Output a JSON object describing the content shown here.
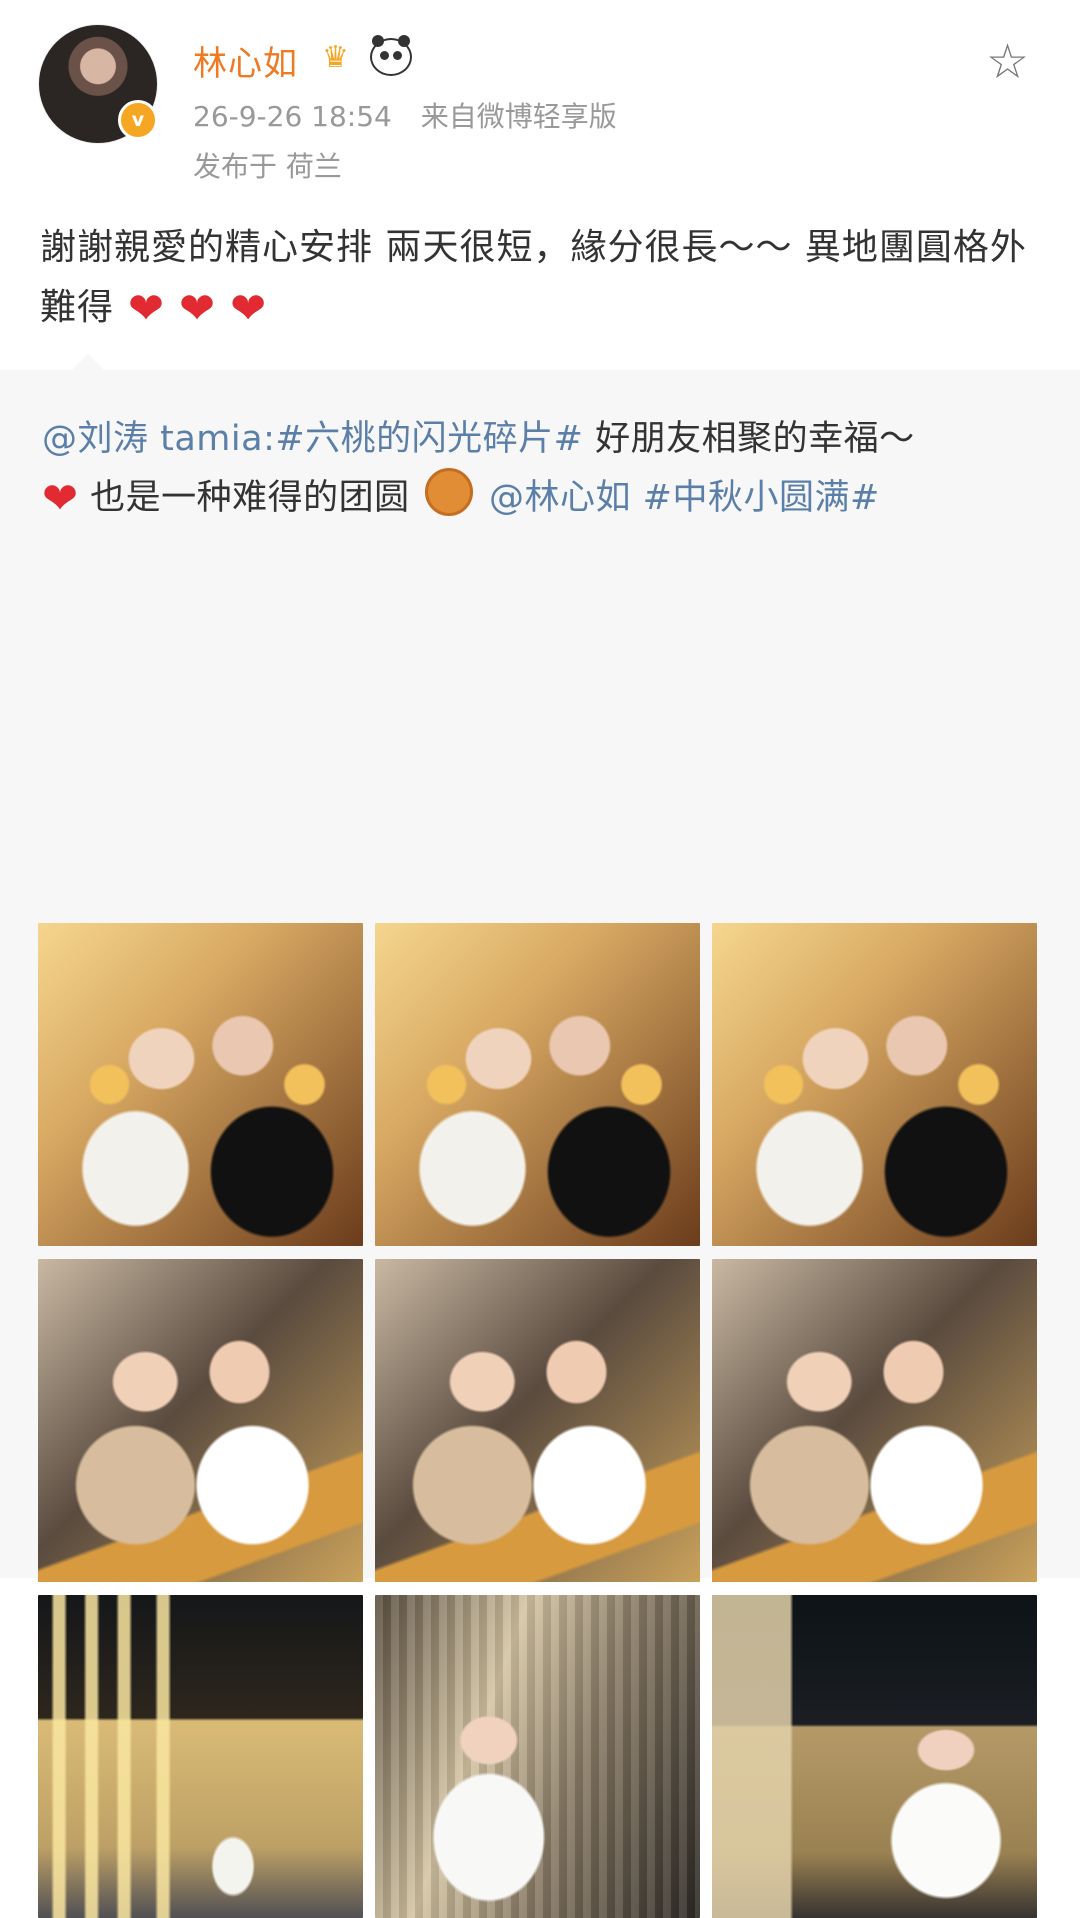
{
  "post": {
    "username": "林心如",
    "timestamp": "26-9-26 18:54",
    "source": "来自微博轻享版",
    "location": "发布于 荷兰",
    "text": "謝謝親愛的精心安排 兩天很短，緣分很長～～ 異地團圓格外難得"
  },
  "repost": {
    "mention": "@刘涛 tamia:",
    "hashtag_1": "#六桃的闪光碎片#",
    "text_1": " 好朋友相聚的幸福～",
    "text_2": "也是一种难得的团圆",
    "mention_2": "@林心如",
    "hashtag_2": "#中秋小圆满#"
  },
  "icons": {
    "verified": "verified-badge",
    "crown": "crown-icon",
    "panda": "panda-icon",
    "star": "star-icon",
    "heart": "heart-icon",
    "mooncake": "mooncake-icon"
  },
  "colors": {
    "username": "#ee7a23",
    "link": "#5b7fa8",
    "heart": "#e22a32",
    "background_repost": "#f7f7f7"
  },
  "photos": [
    {
      "alt": "photo-1"
    },
    {
      "alt": "photo-2"
    },
    {
      "alt": "photo-3"
    },
    {
      "alt": "photo-4"
    },
    {
      "alt": "photo-5"
    },
    {
      "alt": "photo-6"
    },
    {
      "alt": "photo-7"
    },
    {
      "alt": "photo-8"
    },
    {
      "alt": "photo-9"
    }
  ]
}
